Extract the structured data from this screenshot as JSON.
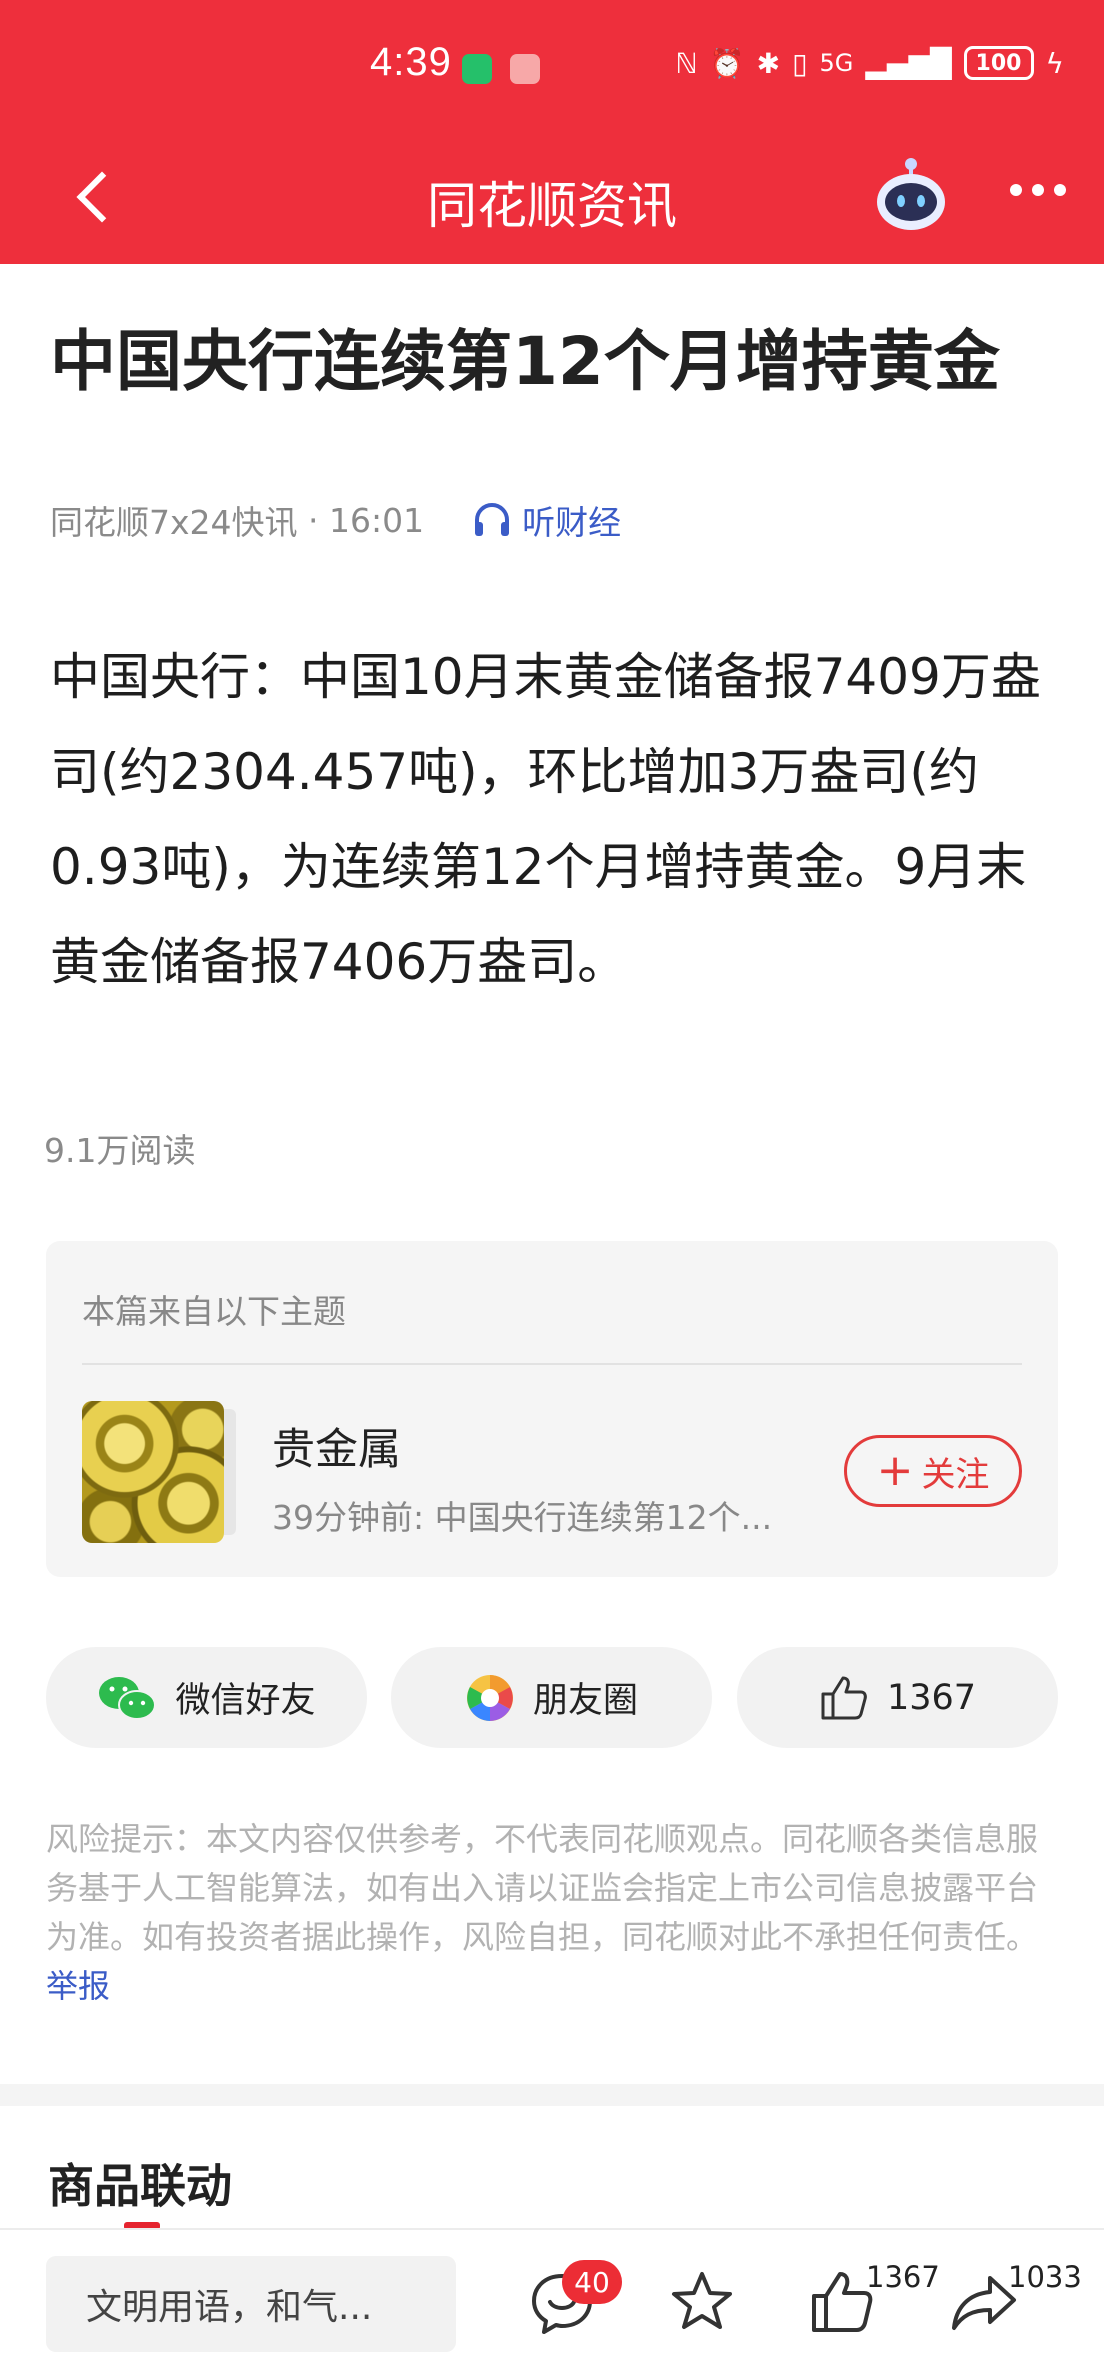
{
  "status_bar": {
    "time": "4:39",
    "network": "5G",
    "battery": "100"
  },
  "header": {
    "title": "同花顺资讯"
  },
  "article": {
    "title": "中国央行连续第12个月增持黄金",
    "source": "同花顺7x24快讯",
    "time": "16:01",
    "listen_label": "听财经",
    "body": "中国央行：中国10月末黄金储备报7409万盎司(约2304.457吨)，环比增加3万盎司(约0.93吨)，为连续第12个月增持黄金。9月末黄金储备报7406万盎司。",
    "reads": "9.1万阅读"
  },
  "topic": {
    "heading": "本篇来自以下主题",
    "name": "贵金属",
    "subtitle": "39分钟前: 中国央行连续第12个...",
    "follow_label": "关注"
  },
  "share": {
    "wechat_label": "微信好友",
    "moments_label": "朋友圈",
    "like_count": "1367"
  },
  "disclaimer": {
    "text": "风险提示：本文内容仅供参考，不代表同花顺观点。同花顺各类信息服务基于人工智能算法，如有出入请以证监会指定上市公司信息披露平台为准。如有投资者据此操作，风险自担，同花顺对此不承担任何责任。",
    "report_label": "举报"
  },
  "section": {
    "title": "商品联动"
  },
  "bottom_bar": {
    "comment_placeholder": "文明用语，和气...",
    "comment_badge": "40",
    "like_count": "1367",
    "share_count": "1033"
  },
  "colors": {
    "brand_red": "#ee2f3c",
    "link_blue": "#3b5cc7",
    "follow_red": "#e33b3b"
  },
  "icons": [
    "back-icon",
    "robot-icon",
    "more-icon",
    "headphone-icon",
    "wechat-icon",
    "moments-icon",
    "thumb-up-icon",
    "comment-icon",
    "star-icon",
    "share-icon",
    "nfc-icon",
    "alarm-icon",
    "bluetooth-icon",
    "vibrate-icon",
    "signal-icon",
    "charging-icon"
  ]
}
